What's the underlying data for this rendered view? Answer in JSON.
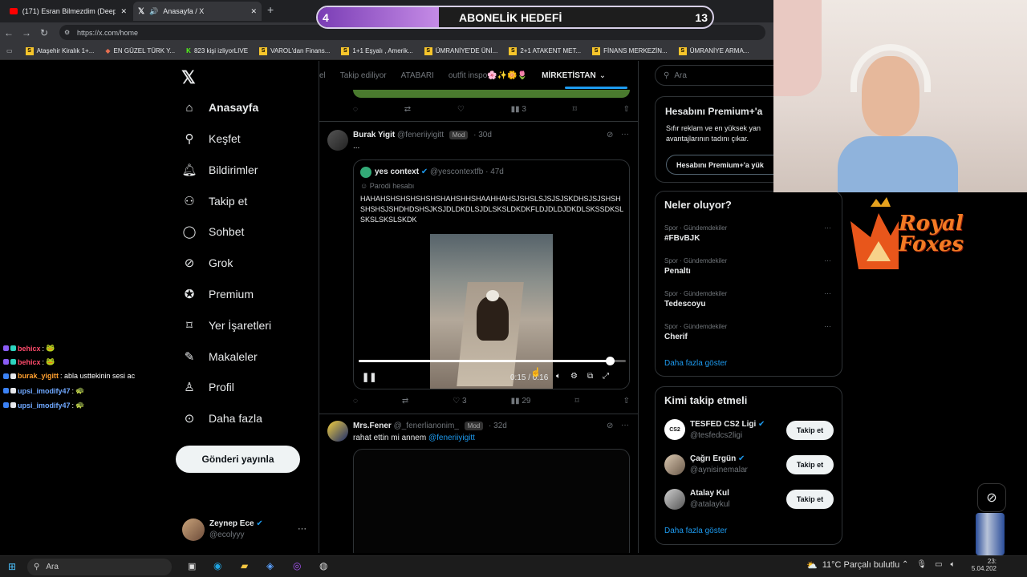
{
  "browser": {
    "tabs": [
      {
        "title": "(171) Esran Bilmezdim (Deep Turk..."
      },
      {
        "title": "Anasayfa / X"
      }
    ],
    "url": "https://x.com/home",
    "bookmarks": [
      "Ataşehir Kiralık 1+...",
      "EN GÜZEL TÜRK Y...",
      "823 kişi izliyorLIVE",
      "VAROL'dan Finans...",
      "1+1 Eşyalı , Amerik...",
      "ÜMRANİYE'DE ÜNİ...",
      "2+1 ATAKENT MET...",
      "FİNANS MERKEZİN...",
      "ÜMRANİYE ARMA..."
    ]
  },
  "overlay": {
    "goal_label": "ABONELİK HEDEFİ",
    "goal_current": "4",
    "goal_target": "13",
    "goal_progress": 0.3077,
    "team_logo": "Royal Foxes"
  },
  "sidebar": {
    "items": [
      {
        "label": "Anasayfa",
        "icon": "home-icon"
      },
      {
        "label": "Keşfet",
        "icon": "search-icon"
      },
      {
        "label": "Bildirimler",
        "icon": "bell-icon"
      },
      {
        "label": "Takip et",
        "icon": "add-person-icon"
      },
      {
        "label": "Sohbet",
        "icon": "chat-icon"
      },
      {
        "label": "Grok",
        "icon": "grok-icon"
      },
      {
        "label": "Premium",
        "icon": "verified-icon"
      },
      {
        "label": "Yer İşaretleri",
        "icon": "bookmark-icon"
      },
      {
        "label": "Makaleler",
        "icon": "article-icon"
      },
      {
        "label": "Profil",
        "icon": "person-icon"
      },
      {
        "label": "Daha fazla",
        "icon": "more-circle-icon"
      }
    ],
    "post_button": "Gönderi yayınla",
    "account": {
      "name": "Zeynep Ece",
      "handle": "@ecolyyy"
    }
  },
  "timeline": {
    "tabs": [
      "el",
      "Takip ediliyor",
      "ATABARI",
      "outfit inspo🌸✨🌼🌷",
      "MİRKETİSTAN"
    ],
    "prev_actions": {
      "views": "3"
    },
    "tweet1": {
      "name": "Burak Yigit",
      "handle": "@feneriiyigitt",
      "badge": "Mod",
      "time": "30d",
      "text": "...",
      "quote": {
        "name": "yes context",
        "handle": "@yescontextfb",
        "time": "47d",
        "label": "Parodi hesabı",
        "text": "HAHAHSHSHSHSHSHSHAHSHHSHAAHHAHSJSHSLSJSJSJSKDHSJSJSHSHSHSHSJSHDHDSHSJKSJDLDKDLSJDLSKSLDKDKFLDJDLDJDKDLSKSSDKSLSKSLSKSLSKDK"
      },
      "video": {
        "time": "0:15 / 0:16",
        "progress": 0.94
      },
      "likes": "3",
      "views": "29"
    },
    "tweet2": {
      "name": "Mrs.Fener",
      "handle": "@_fenerlianonim_",
      "badge": "Mod",
      "time": "32d",
      "text": "rahat ettin mi annem",
      "mention": "@feneriiyigitt"
    }
  },
  "right": {
    "search_placeholder": "Ara",
    "premium": {
      "title": "Hesabını Premium+'a",
      "desc": "Sıfır reklam ve en yüksek yan avantajlarının tadını çıkar.",
      "button": "Hesabını Premium+'a yük"
    },
    "trends": {
      "title": "Neler oluyor?",
      "items": [
        {
          "category": "Spor · Gündemdekiler",
          "name": "#FBvBJK"
        },
        {
          "category": "Spor · Gündemdekiler",
          "name": "Penaltı"
        },
        {
          "category": "Spor · Gündemdekiler",
          "name": "Tedescoyu"
        },
        {
          "category": "Spor · Gündemdekiler",
          "name": "Cherif"
        }
      ],
      "more": "Daha fazla göster"
    },
    "who_to_follow": {
      "title": "Kimi takip etmeli",
      "items": [
        {
          "name": "TESFED CS2 Ligi",
          "handle": "@tesfedcs2ligi",
          "button": "Takip et"
        },
        {
          "name": "Çağrı Ergün",
          "handle": "@aynisinemalar",
          "button": "Takip et"
        },
        {
          "name": "Atalay Kul",
          "handle": "@atalaykul",
          "button": "Takip et"
        }
      ],
      "more": "Daha fazla göster"
    }
  },
  "chat": [
    {
      "user": "behicx",
      "message": ":"
    },
    {
      "user": "behicx",
      "message": ":"
    },
    {
      "user": "burak_yigitt",
      "message": ": abla usttekinin sesi ac"
    },
    {
      "user": "upsi_imodify47",
      "message": ":"
    },
    {
      "user": "upsi_imodify47",
      "message": ":"
    }
  ],
  "chat_colors": [
    "#ff4b6b",
    "#ff4b6b",
    "#ff9f2e",
    "#6fa8ff",
    "#6fa8ff"
  ],
  "taskbar": {
    "search": "Ara",
    "weather": "11°C  Parçalı bulutlu",
    "time": "23:",
    "date": "5.04.202"
  }
}
